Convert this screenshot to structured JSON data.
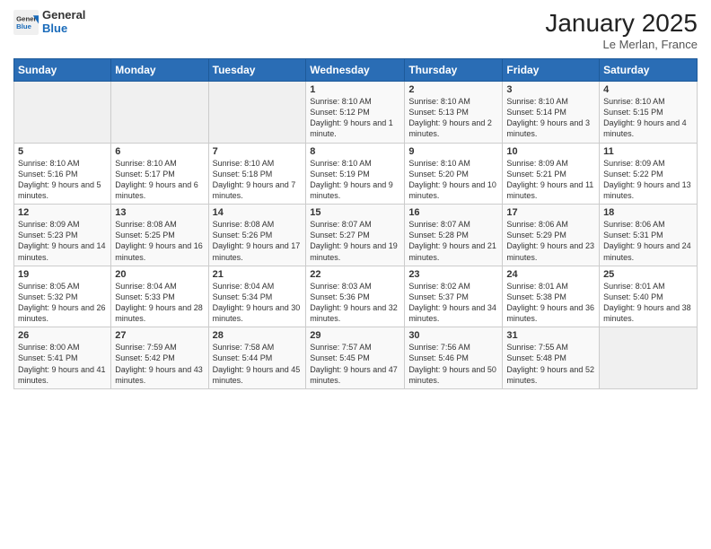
{
  "logo": {
    "line1": "General",
    "line2": "Blue"
  },
  "title": "January 2025",
  "location": "Le Merlan, France",
  "days_of_week": [
    "Sunday",
    "Monday",
    "Tuesday",
    "Wednesday",
    "Thursday",
    "Friday",
    "Saturday"
  ],
  "weeks": [
    [
      {
        "day": "",
        "sunrise": "",
        "sunset": "",
        "daylight": "",
        "empty": true
      },
      {
        "day": "",
        "sunrise": "",
        "sunset": "",
        "daylight": "",
        "empty": true
      },
      {
        "day": "",
        "sunrise": "",
        "sunset": "",
        "daylight": "",
        "empty": true
      },
      {
        "day": "1",
        "sunrise": "Sunrise: 8:10 AM",
        "sunset": "Sunset: 5:12 PM",
        "daylight": "Daylight: 9 hours and 1 minute."
      },
      {
        "day": "2",
        "sunrise": "Sunrise: 8:10 AM",
        "sunset": "Sunset: 5:13 PM",
        "daylight": "Daylight: 9 hours and 2 minutes."
      },
      {
        "day": "3",
        "sunrise": "Sunrise: 8:10 AM",
        "sunset": "Sunset: 5:14 PM",
        "daylight": "Daylight: 9 hours and 3 minutes."
      },
      {
        "day": "4",
        "sunrise": "Sunrise: 8:10 AM",
        "sunset": "Sunset: 5:15 PM",
        "daylight": "Daylight: 9 hours and 4 minutes."
      }
    ],
    [
      {
        "day": "5",
        "sunrise": "Sunrise: 8:10 AM",
        "sunset": "Sunset: 5:16 PM",
        "daylight": "Daylight: 9 hours and 5 minutes."
      },
      {
        "day": "6",
        "sunrise": "Sunrise: 8:10 AM",
        "sunset": "Sunset: 5:17 PM",
        "daylight": "Daylight: 9 hours and 6 minutes."
      },
      {
        "day": "7",
        "sunrise": "Sunrise: 8:10 AM",
        "sunset": "Sunset: 5:18 PM",
        "daylight": "Daylight: 9 hours and 7 minutes."
      },
      {
        "day": "8",
        "sunrise": "Sunrise: 8:10 AM",
        "sunset": "Sunset: 5:19 PM",
        "daylight": "Daylight: 9 hours and 9 minutes."
      },
      {
        "day": "9",
        "sunrise": "Sunrise: 8:10 AM",
        "sunset": "Sunset: 5:20 PM",
        "daylight": "Daylight: 9 hours and 10 minutes."
      },
      {
        "day": "10",
        "sunrise": "Sunrise: 8:09 AM",
        "sunset": "Sunset: 5:21 PM",
        "daylight": "Daylight: 9 hours and 11 minutes."
      },
      {
        "day": "11",
        "sunrise": "Sunrise: 8:09 AM",
        "sunset": "Sunset: 5:22 PM",
        "daylight": "Daylight: 9 hours and 13 minutes."
      }
    ],
    [
      {
        "day": "12",
        "sunrise": "Sunrise: 8:09 AM",
        "sunset": "Sunset: 5:23 PM",
        "daylight": "Daylight: 9 hours and 14 minutes."
      },
      {
        "day": "13",
        "sunrise": "Sunrise: 8:08 AM",
        "sunset": "Sunset: 5:25 PM",
        "daylight": "Daylight: 9 hours and 16 minutes."
      },
      {
        "day": "14",
        "sunrise": "Sunrise: 8:08 AM",
        "sunset": "Sunset: 5:26 PM",
        "daylight": "Daylight: 9 hours and 17 minutes."
      },
      {
        "day": "15",
        "sunrise": "Sunrise: 8:07 AM",
        "sunset": "Sunset: 5:27 PM",
        "daylight": "Daylight: 9 hours and 19 minutes."
      },
      {
        "day": "16",
        "sunrise": "Sunrise: 8:07 AM",
        "sunset": "Sunset: 5:28 PM",
        "daylight": "Daylight: 9 hours and 21 minutes."
      },
      {
        "day": "17",
        "sunrise": "Sunrise: 8:06 AM",
        "sunset": "Sunset: 5:29 PM",
        "daylight": "Daylight: 9 hours and 23 minutes."
      },
      {
        "day": "18",
        "sunrise": "Sunrise: 8:06 AM",
        "sunset": "Sunset: 5:31 PM",
        "daylight": "Daylight: 9 hours and 24 minutes."
      }
    ],
    [
      {
        "day": "19",
        "sunrise": "Sunrise: 8:05 AM",
        "sunset": "Sunset: 5:32 PM",
        "daylight": "Daylight: 9 hours and 26 minutes."
      },
      {
        "day": "20",
        "sunrise": "Sunrise: 8:04 AM",
        "sunset": "Sunset: 5:33 PM",
        "daylight": "Daylight: 9 hours and 28 minutes."
      },
      {
        "day": "21",
        "sunrise": "Sunrise: 8:04 AM",
        "sunset": "Sunset: 5:34 PM",
        "daylight": "Daylight: 9 hours and 30 minutes."
      },
      {
        "day": "22",
        "sunrise": "Sunrise: 8:03 AM",
        "sunset": "Sunset: 5:36 PM",
        "daylight": "Daylight: 9 hours and 32 minutes."
      },
      {
        "day": "23",
        "sunrise": "Sunrise: 8:02 AM",
        "sunset": "Sunset: 5:37 PM",
        "daylight": "Daylight: 9 hours and 34 minutes."
      },
      {
        "day": "24",
        "sunrise": "Sunrise: 8:01 AM",
        "sunset": "Sunset: 5:38 PM",
        "daylight": "Daylight: 9 hours and 36 minutes."
      },
      {
        "day": "25",
        "sunrise": "Sunrise: 8:01 AM",
        "sunset": "Sunset: 5:40 PM",
        "daylight": "Daylight: 9 hours and 38 minutes."
      }
    ],
    [
      {
        "day": "26",
        "sunrise": "Sunrise: 8:00 AM",
        "sunset": "Sunset: 5:41 PM",
        "daylight": "Daylight: 9 hours and 41 minutes."
      },
      {
        "day": "27",
        "sunrise": "Sunrise: 7:59 AM",
        "sunset": "Sunset: 5:42 PM",
        "daylight": "Daylight: 9 hours and 43 minutes."
      },
      {
        "day": "28",
        "sunrise": "Sunrise: 7:58 AM",
        "sunset": "Sunset: 5:44 PM",
        "daylight": "Daylight: 9 hours and 45 minutes."
      },
      {
        "day": "29",
        "sunrise": "Sunrise: 7:57 AM",
        "sunset": "Sunset: 5:45 PM",
        "daylight": "Daylight: 9 hours and 47 minutes."
      },
      {
        "day": "30",
        "sunrise": "Sunrise: 7:56 AM",
        "sunset": "Sunset: 5:46 PM",
        "daylight": "Daylight: 9 hours and 50 minutes."
      },
      {
        "day": "31",
        "sunrise": "Sunrise: 7:55 AM",
        "sunset": "Sunset: 5:48 PM",
        "daylight": "Daylight: 9 hours and 52 minutes."
      },
      {
        "day": "",
        "sunrise": "",
        "sunset": "",
        "daylight": "",
        "empty": true
      }
    ]
  ]
}
